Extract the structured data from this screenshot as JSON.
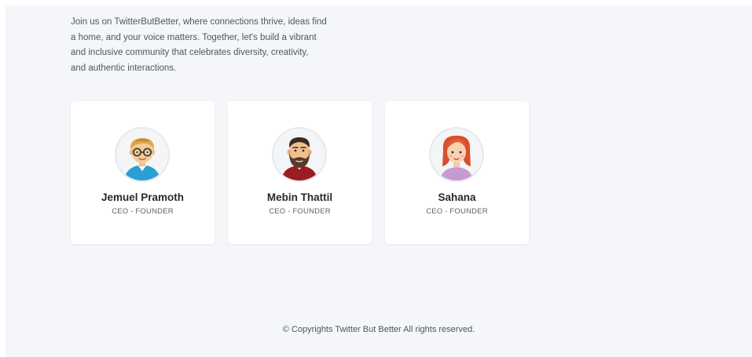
{
  "intro": {
    "line1": "Join us on TwitterButBetter, where connections thrive, ideas find",
    "line2": "a home, and your voice matters. Together, let's build a vibrant",
    "line3": "and inclusive community that celebrates diversity, creativity,",
    "line4": "and authentic interactions."
  },
  "team": [
    {
      "name": "Jemuel Pramoth",
      "role": "CEO - FOUNDER",
      "avatar_icon": "glasses-man-avatar-icon"
    },
    {
      "name": "Mebin Thattil",
      "role": "CEO - FOUNDER",
      "avatar_icon": "bearded-man-avatar-icon"
    },
    {
      "name": "Sahana",
      "role": "CEO - FOUNDER",
      "avatar_icon": "woman-avatar-icon"
    }
  ],
  "footer": {
    "text": "© Copyrights Twitter But Better All rights reserved."
  },
  "colors": {
    "page_bg": "#f4f6f9",
    "card_bg": "#ffffff",
    "name_text": "#262a30",
    "body_text": "#4f5660"
  }
}
